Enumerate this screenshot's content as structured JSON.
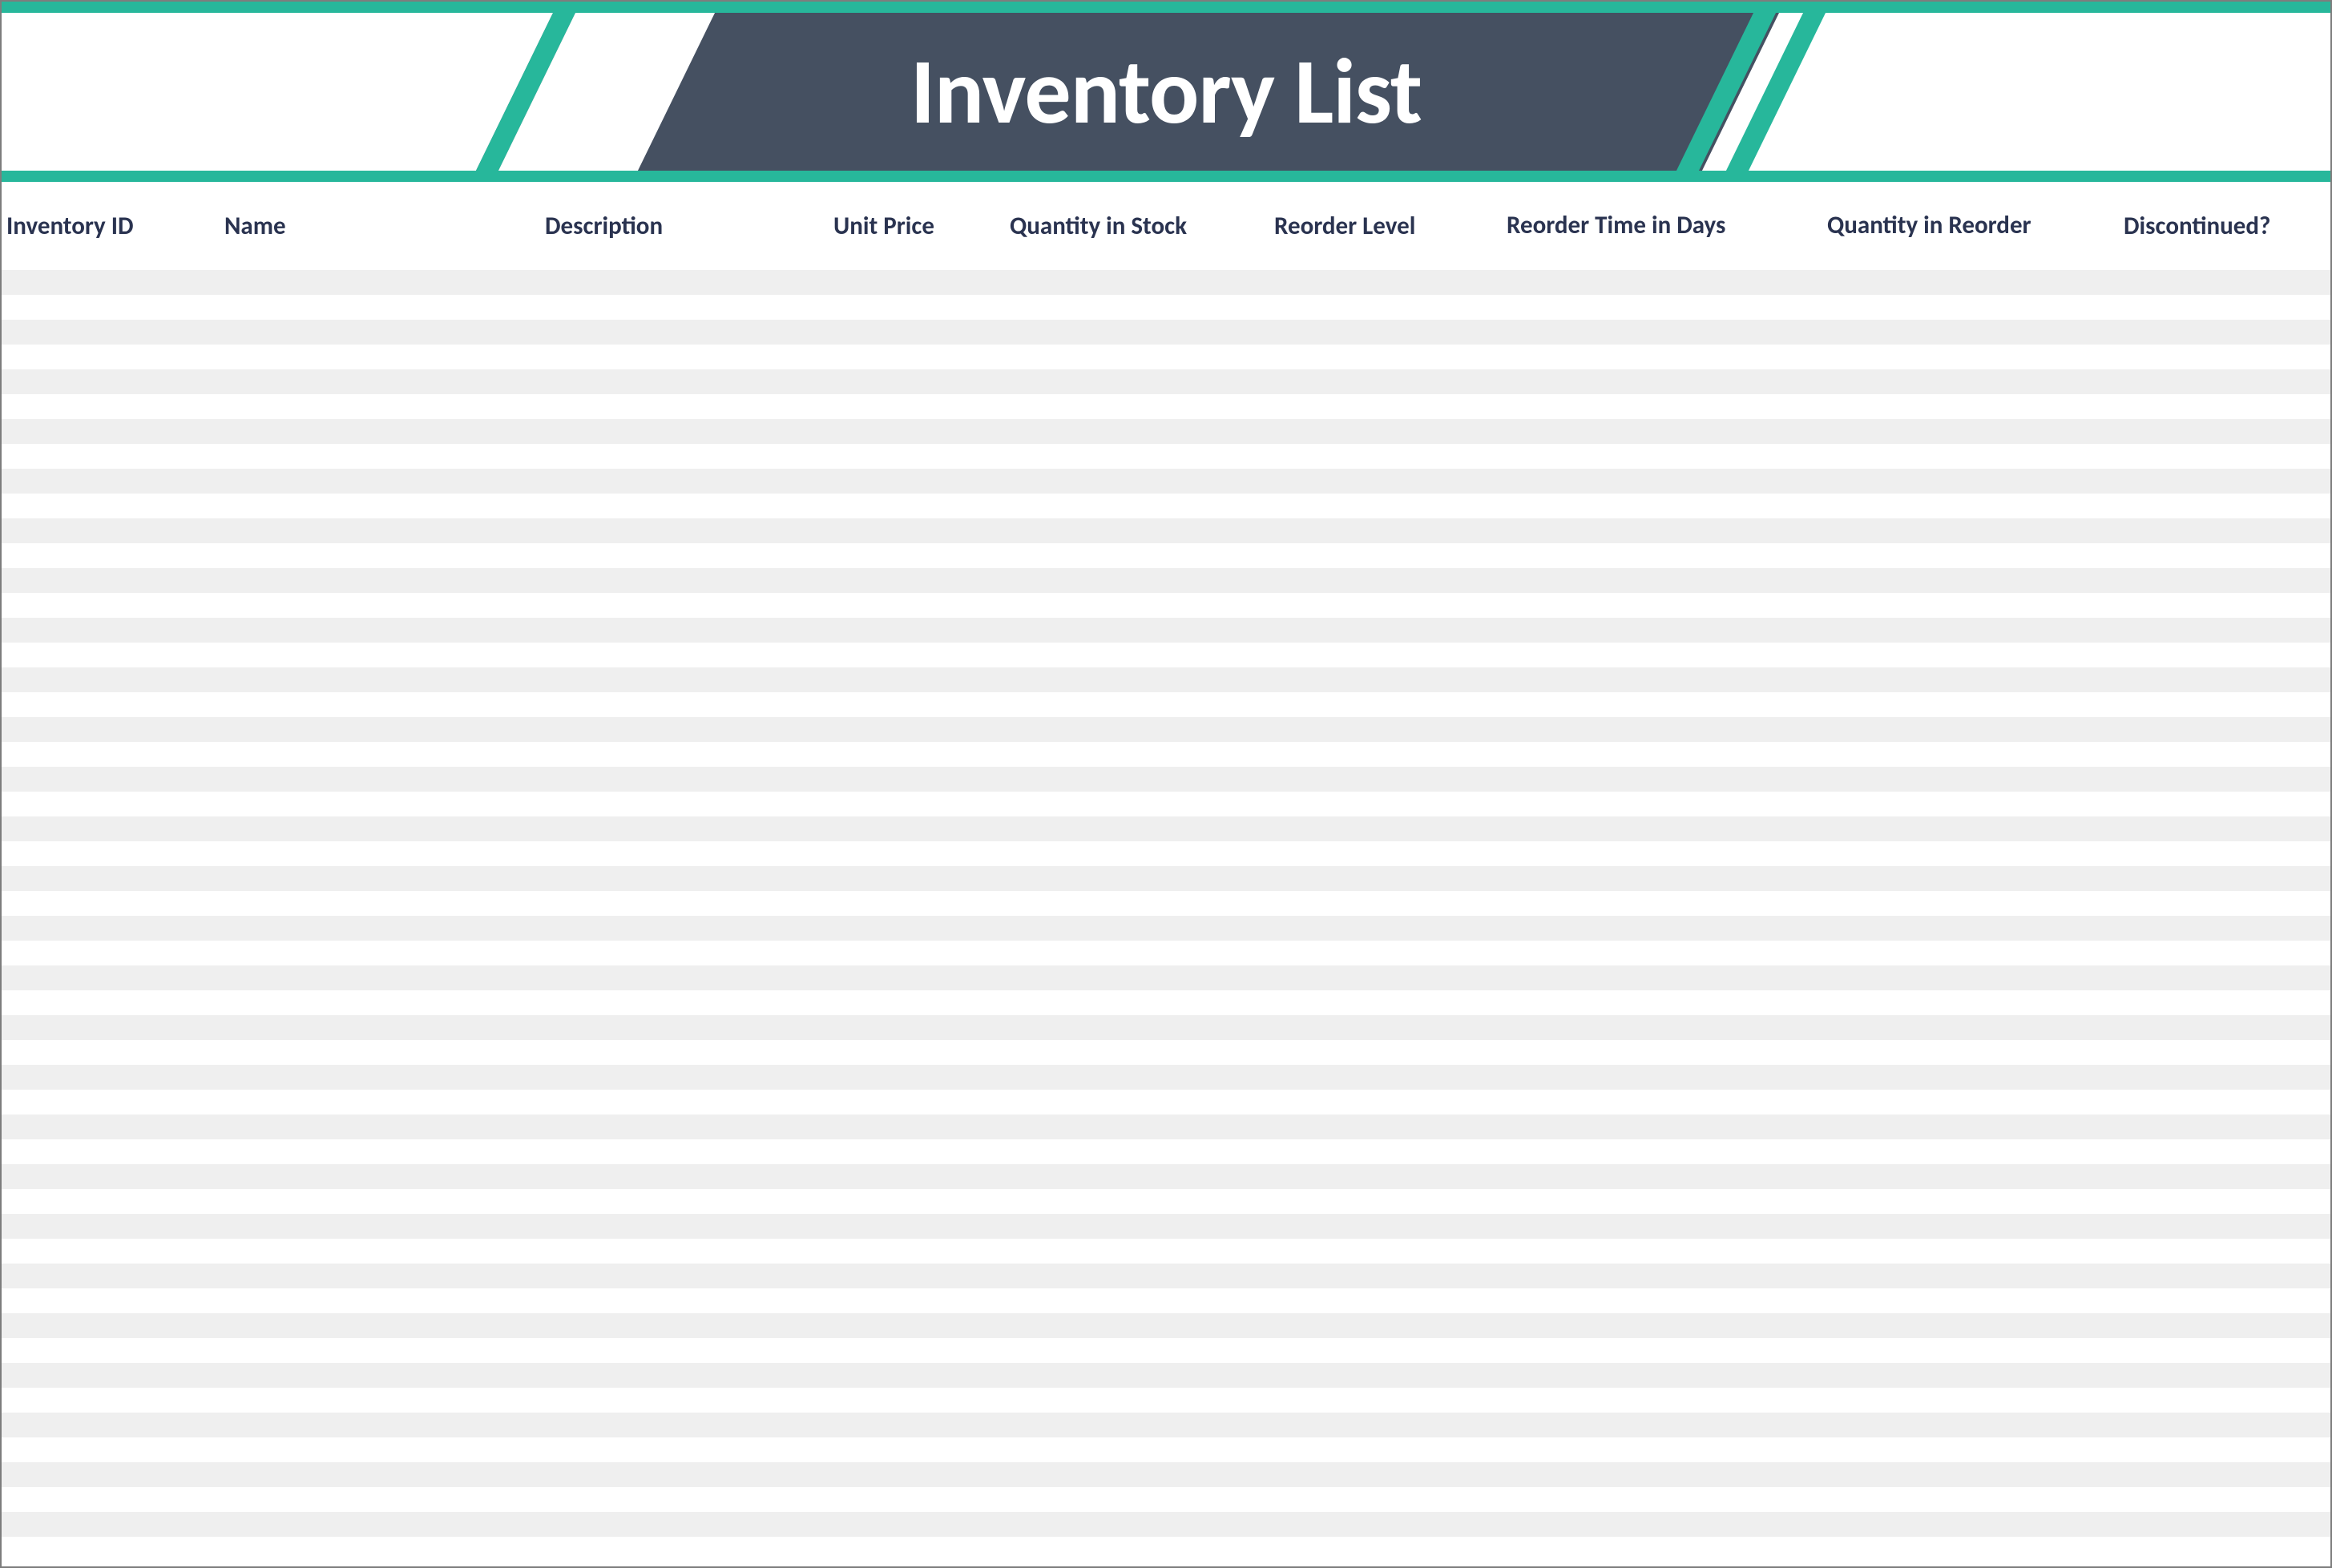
{
  "banner": {
    "title": "Inventory List"
  },
  "colors": {
    "accent": "#27b79b",
    "banner_bg": "#455061",
    "header_text": "#2a3350",
    "row_alt": "#efefef"
  },
  "columns": [
    {
      "label": "Inventory ID"
    },
    {
      "label": "Name"
    },
    {
      "label": "Description"
    },
    {
      "label": "Unit Price"
    },
    {
      "label": "Quantity in Stock"
    },
    {
      "label": "Reorder Level"
    },
    {
      "label": "Reorder Time in Days"
    },
    {
      "label": "Quantity in Reorder"
    },
    {
      "label": "Discontinued?"
    }
  ],
  "rows": [
    {},
    {},
    {},
    {},
    {},
    {},
    {},
    {},
    {},
    {},
    {},
    {},
    {},
    {},
    {},
    {},
    {},
    {},
    {},
    {},
    {},
    {},
    {},
    {},
    {},
    {},
    {},
    {},
    {},
    {},
    {},
    {},
    {},
    {},
    {},
    {},
    {},
    {},
    {},
    {},
    {},
    {},
    {},
    {},
    {},
    {},
    {},
    {},
    {},
    {},
    {},
    {}
  ]
}
